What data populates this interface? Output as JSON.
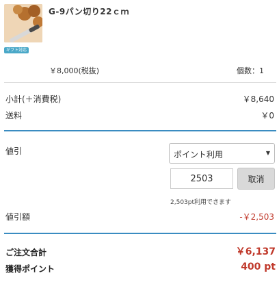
{
  "product": {
    "image_icon": "bread-knife-product-photo",
    "gift_badge": "ギフト対応",
    "name": "G-9パン切り22ｃｍ",
    "price": "￥8,000(税抜)",
    "quantity": "個数：1"
  },
  "summary": {
    "subtotal_label": "小計(＋消費税)",
    "subtotal_value": "￥8,640",
    "shipping_label": "送料",
    "shipping_value": "￥0"
  },
  "discount": {
    "label": "値引",
    "select_value": "ポイント利用",
    "select_arrow_icon": "triangle-down-icon",
    "point_input_value": "2503",
    "cancel_label": "取消",
    "point_note": "2,503pt利用できます",
    "amount_label": "値引額",
    "amount_value": "-￥2,503"
  },
  "totals": {
    "order_total_label": "ご注文合計",
    "order_total_value": "￥6,137",
    "points_label": "獲得ポイント",
    "points_value": "400 pt"
  },
  "colors": {
    "accent_blue": "#3a8cc1",
    "price_red": "#c0392b",
    "badge_blue": "#4aa8c8",
    "button_gray": "#d9d9d9"
  }
}
